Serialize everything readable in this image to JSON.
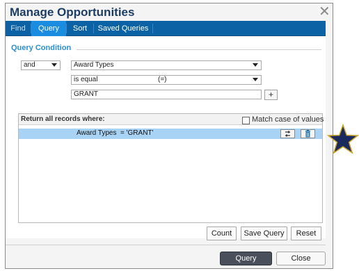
{
  "dialog": {
    "title": "Manage Opportunities",
    "close_glyph": "✕"
  },
  "tabs": [
    {
      "label": "Find",
      "active": false
    },
    {
      "label": "Query",
      "active": true
    },
    {
      "label": "Sort",
      "active": false
    },
    {
      "label": "Saved Queries",
      "active": false
    }
  ],
  "query_condition": {
    "legend": "Query Condition",
    "logic_value": "and",
    "field_value": "Award Types",
    "operator_value": "is equal",
    "operator_symbol": "(=)",
    "value_input": "GRANT",
    "add_label": "+"
  },
  "records": {
    "title": "Return all records where:",
    "match_case_label": "Match case of values",
    "match_case_checked": false,
    "rows": [
      {
        "text": "Award Types  = 'GRANT'",
        "selected": true
      }
    ]
  },
  "actions": {
    "count_label": "Count",
    "save_query_label": "Save Query",
    "reset_label": "Reset"
  },
  "footer": {
    "query_label": "Query",
    "close_label": "Close"
  },
  "colors": {
    "tab_bar": "#0b63a5",
    "tab_active": "#1b8de0",
    "title": "#1e3d63",
    "row_selected": "#a9d3f5",
    "primary_button": "#4a4f5c",
    "star": "#1b2a5c"
  }
}
